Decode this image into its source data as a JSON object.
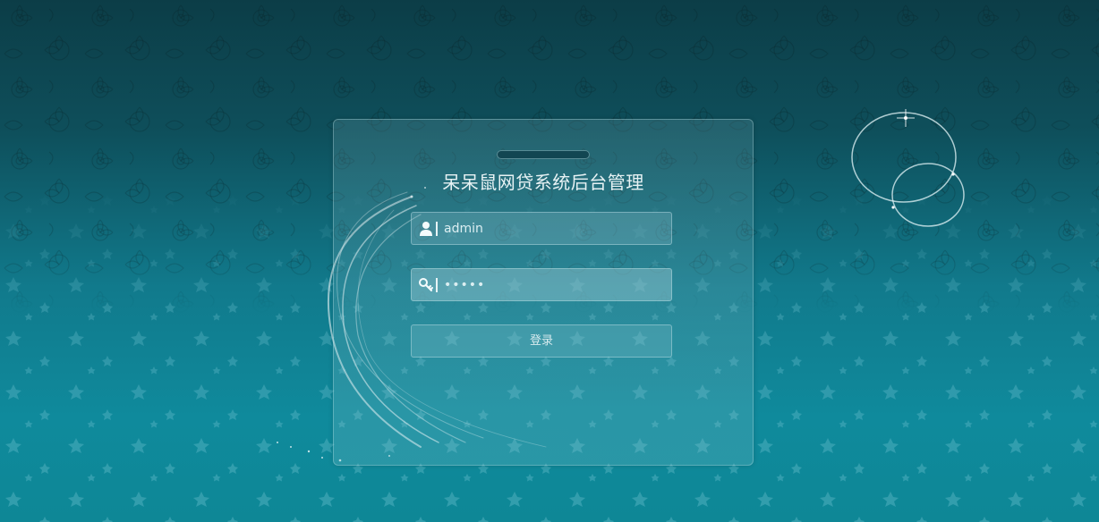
{
  "login": {
    "title": "呆呆鼠网贷系统后台管理",
    "username": {
      "value": "admin",
      "icon": "user-icon"
    },
    "password": {
      "value": "•••••",
      "icon": "key-icon"
    },
    "submit_label": "登录"
  },
  "colors": {
    "background_top": "#0c3d47",
    "background_bottom": "#0e8796",
    "title_text": "#e7f2f4",
    "field_border": "#bee1e6"
  }
}
